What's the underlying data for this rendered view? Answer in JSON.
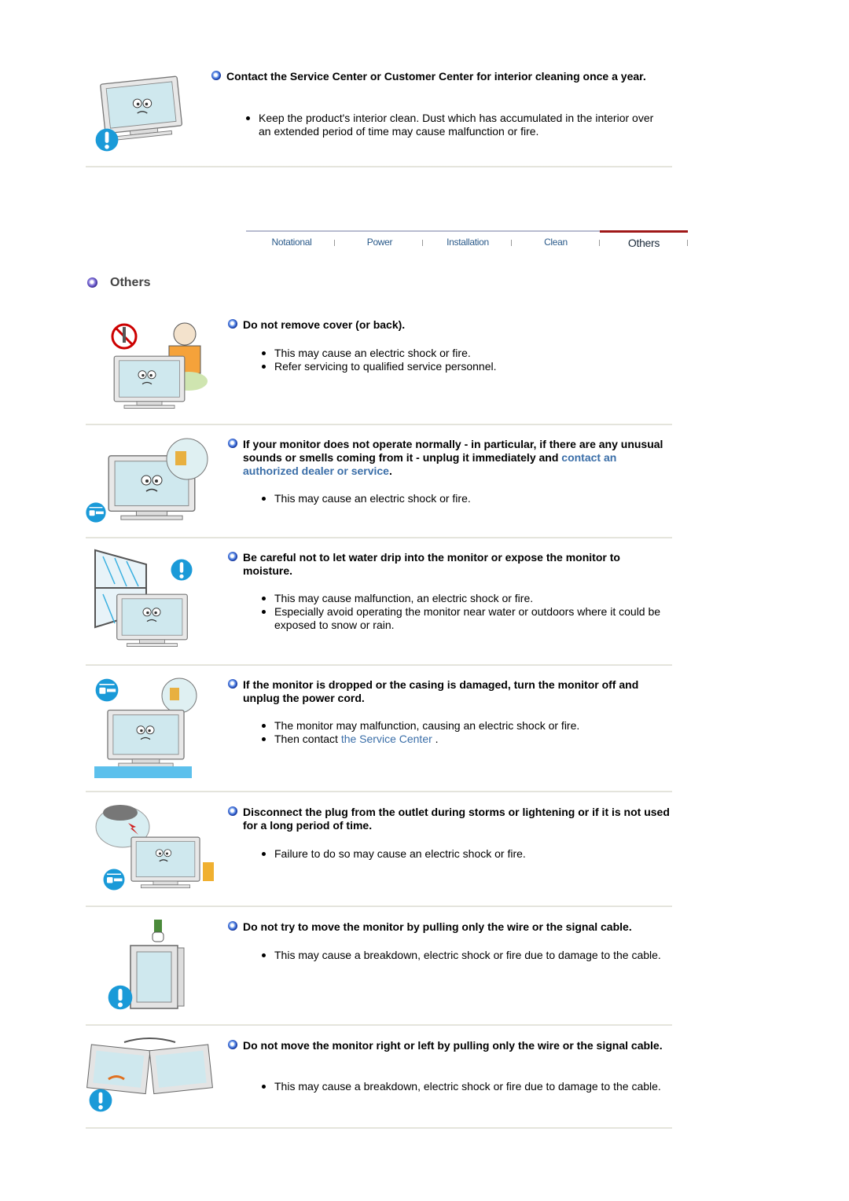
{
  "top_item": {
    "heading": "Contact the Service Center or Customer Center for interior cleaning once a year.",
    "bullets": [
      "Keep the product's interior clean. Dust which has accumulated in the interior over an extended period of time may cause malfunction or fire."
    ]
  },
  "nav": {
    "tabs": [
      {
        "label": "Notational",
        "active": false
      },
      {
        "label": "Power",
        "active": false
      },
      {
        "label": "Installation",
        "active": false
      },
      {
        "label": "Clean",
        "active": false
      },
      {
        "label": "Others",
        "active": true
      }
    ],
    "active_color": "#a01818"
  },
  "section": {
    "title": "Others"
  },
  "items": [
    {
      "heading": "Do not remove cover (or back).",
      "bullets": [
        "This may cause an electric shock or fire.",
        "Refer servicing to qualified service personnel."
      ]
    },
    {
      "heading": "If your monitor does not operate normally - in particular, if there are any unusual sounds or smells coming from it - unplug it immediately and ",
      "heading_link": "contact an authorized dealer or service",
      "heading_end": ".",
      "bullets": [
        "This may cause an electric shock or fire."
      ]
    },
    {
      "heading": "Be careful not to let water drip into the monitor or expose the monitor to moisture.",
      "bullets": [
        "This may cause malfunction, an electric shock or fire.",
        "Especially avoid operating the monitor near water or outdoors where it could be exposed to snow or rain."
      ]
    },
    {
      "heading": "If the monitor is dropped or the casing is damaged, turn the monitor off and unplug the power cord.",
      "bullets": [
        "The monitor may malfunction, causing an electric shock or fire."
      ],
      "link_bullet": {
        "prefix": "Then contact ",
        "link": "the Service Center",
        "suffix": " ."
      }
    },
    {
      "heading": "Disconnect the plug from the outlet during storms or lightening or if it is not used for a long period of time.",
      "bullets": [
        "Failure to do so may cause an electric shock or fire."
      ]
    },
    {
      "heading": "Do not try to move the monitor by pulling only the wire or the signal cable.",
      "bullets": [
        "This may cause a breakdown, electric shock or fire due to damage to the cable."
      ]
    },
    {
      "heading": "Do not move the monitor right or left by pulling only the wire or the signal cable.",
      "bullets": [
        "This may cause a breakdown, electric shock or fire due to damage to the cable."
      ]
    }
  ],
  "colors": {
    "link": "#3a6ea8",
    "warning_blue": "#1a9ad8"
  }
}
